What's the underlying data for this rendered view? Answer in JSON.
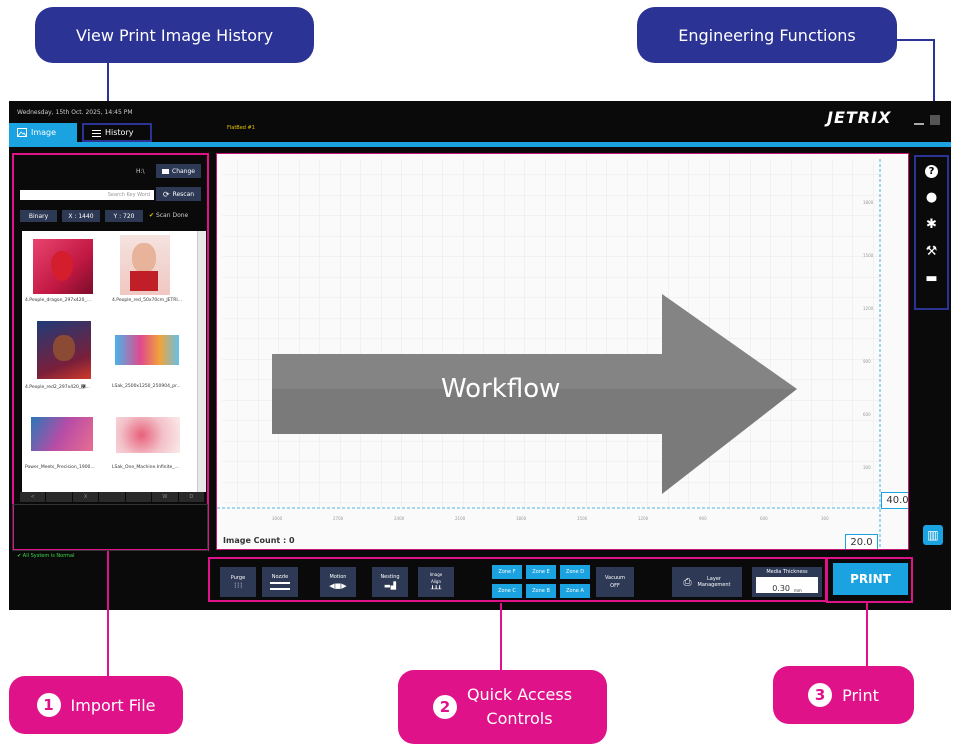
{
  "callouts": {
    "history": "View Print Image History",
    "engineering": "Engineering Functions",
    "import_num": "1",
    "import": "Import File",
    "quick_num": "2",
    "quick_line1": "Quick Access",
    "quick_line2": "Controls",
    "print_num": "3",
    "print": "Print"
  },
  "app": {
    "datetime": "Wednesday, 15th Oct. 2025, 14:45 PM",
    "logo": "JETRIX",
    "flatbed": "FlatBed #1",
    "status": "All System is Normal"
  },
  "tabs": {
    "image": "Image",
    "history": "History"
  },
  "left": {
    "folder": "H:\\",
    "change": "Change",
    "search_placeholder": "Search Key Word",
    "rescan": "Rescan",
    "binary": "Binary",
    "x_res": "X : 1440",
    "y_res": "Y : 720",
    "scan_done": "Scan Done",
    "files": [
      "4.People_dragon_297x420_...",
      "4.People_red_50x70cm_JETRI...",
      "4.People_red2_297x420_࿤...",
      "LSak_2500x1250_250904_pr...",
      "Power_Meets_Precision_1900...",
      "LSak_One_Machine.Infinite_..."
    ],
    "pager": [
      "<",
      "",
      "X",
      "",
      "",
      "W",
      "D"
    ]
  },
  "canvas": {
    "workflow": "Workflow",
    "image_count": "Image Count : 0",
    "val_right": "40.0",
    "val_bottom": "20.0",
    "x_ticks": [
      "3000",
      "2700",
      "2400",
      "2100",
      "1800",
      "1500",
      "1200",
      "900",
      "600",
      "300"
    ],
    "y_ticks": [
      "1800",
      "1500",
      "1200",
      "900",
      "600",
      "300"
    ]
  },
  "quick": {
    "purge": "Purge",
    "nozzle": "Nozzle",
    "motion": "Motion",
    "nesting": "Nesting",
    "image_align_1": "Image",
    "image_align_2": "Align",
    "zones_top": [
      "Zone F",
      "Zone E",
      "Zone D"
    ],
    "zones_bottom": [
      "Zone C",
      "Zone B",
      "Zone A"
    ],
    "vacuum": "Vacuum",
    "vacuum_state": "OFF",
    "layer_1": "Layer",
    "layer_2": "Management",
    "media_label": "Media Thickness",
    "media_value": "0.30",
    "media_unit": "mm",
    "print": "PRINT"
  },
  "colors": {
    "navy": "#2b3394",
    "magenta": "#e0128a",
    "accent_blue": "#1aa3e0",
    "status_green": "#3cd84a"
  }
}
